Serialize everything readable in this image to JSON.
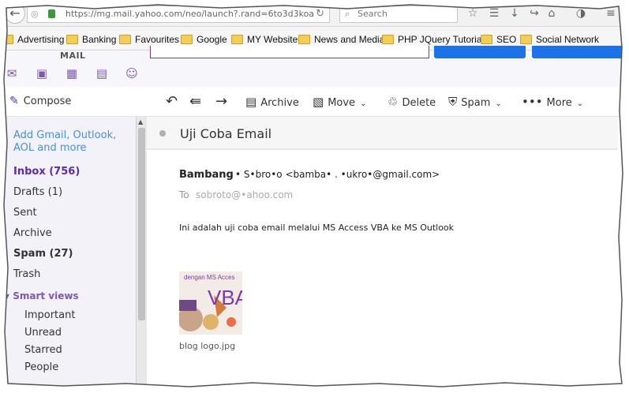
{
  "browser": {
    "url": "https://mg.mail.yahoo.com/neo/launch?.rand=6to3d3koa",
    "search_placeholder": "Search",
    "bookmarks": [
      "Advertising",
      "Banking",
      "Favourites",
      "Google",
      "MY Website",
      "News and Media",
      "PHP JQuery Tutorial",
      "SEO",
      "Social Network"
    ]
  },
  "app": {
    "logo": "MAIL",
    "app_icons": [
      "mail-icon",
      "contacts-icon",
      "calendar-icon",
      "notepad-icon",
      "messenger-icon"
    ]
  },
  "toolbar": {
    "compose": "Compose",
    "archive": "Archive",
    "move": "Move",
    "delete": "Delete",
    "spam": "Spam",
    "more": "More"
  },
  "sidebar": {
    "add_accounts": "Add Gmail, Outlook, AOL and more",
    "folders": [
      {
        "label": "Inbox (756)"
      },
      {
        "label": "Drafts (1)"
      },
      {
        "label": "Sent"
      },
      {
        "label": "Archive"
      },
      {
        "label": "Spam (27)"
      },
      {
        "label": "Trash"
      }
    ],
    "smart_views_label": "Smart views",
    "smart_views": [
      "Important",
      "Unread",
      "Starred",
      "People"
    ]
  },
  "message": {
    "subject": "Uji Coba Email",
    "from_name": "Bambang",
    "from_addr": "• S•bro•o <bamba• . •ukro•@gmail.com>",
    "to_label": "To",
    "to_addr": "sobroto@•ahoo.com",
    "body": "Ini adalah uji coba email melalui MS Access VBA ke MS Outlook",
    "attachment": {
      "name": "blog logo.jpg",
      "thumb_text_top": "dengan MS Acces",
      "thumb_text_big": "VBA"
    }
  },
  "colors": {
    "accent_purple": "#5a2bb0",
    "link_blue": "#4a90d9",
    "button_blue": "#1d72e8"
  }
}
